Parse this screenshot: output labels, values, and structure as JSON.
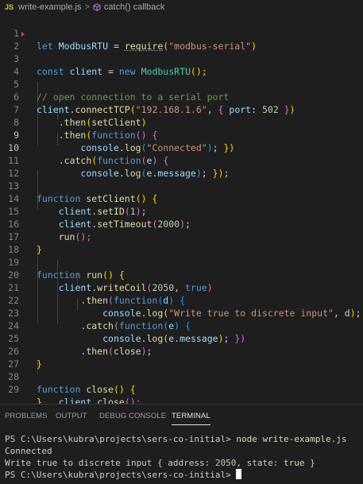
{
  "breadcrumb": {
    "file_badge": "JS",
    "file": "write-example.js",
    "separator": ">",
    "symbol": "catch() callback"
  },
  "editor": {
    "line_numbers": [
      "1",
      "2",
      "3",
      "4",
      "5",
      "6",
      "7",
      "8",
      "9",
      "10",
      "11",
      "12",
      "13",
      "14",
      "15",
      "16",
      "17",
      "18",
      "19",
      "20",
      "21",
      "22",
      "23",
      "24",
      "25",
      "26",
      "27",
      "28",
      "29"
    ],
    "active_line": "9"
  },
  "code": {
    "l1": {
      "let": "let",
      "name": "ModbusRTU",
      "eq": " = ",
      "require": "require",
      "p1": "(",
      "module": "\"modbus-serial\"",
      "p2": ")"
    },
    "l2": {
      "const": "const",
      "sp": " ",
      "client": "client",
      "eq": " = ",
      "new": "new",
      "sp2": " ",
      "cls": "ModbusRTU",
      "parens": "();"
    },
    "l4": {
      "comment": "// open connection to a serial port"
    },
    "l5": {
      "client": "client",
      "dot": ".",
      "fn": "connectTCP",
      "p": "(",
      "ip": "\"192.168.1.6\"",
      "comma": ", ",
      "b": "{",
      "port_key": " port",
      "colon": ": ",
      "port": "502",
      "b2": " }",
      "p2": ")"
    },
    "l6": {
      "dot": ".",
      "then": "then",
      "p": "(",
      "arg": "setClient",
      "p2": ")"
    },
    "l7": {
      "dot": ".",
      "then": "then",
      "p": "(",
      "function": "function",
      "parens": "() ",
      "b": "{"
    },
    "l8": {
      "console": "console",
      "dot": ".",
      "log": "log",
      "p": "(",
      "msg": "\"Connected\"",
      "p2": ")",
      "semi": "; ",
      "b": "})"
    },
    "l9": {
      "dot": ".",
      "catch": "catch",
      "p": "(",
      "function": "function",
      "p3": "(",
      "e": "e",
      "p4": ") ",
      "b": "{"
    },
    "l10": {
      "console": "console",
      "dot": ".",
      "log": "log",
      "p": "(",
      "e": "e",
      "dot2": ".",
      "message": "message",
      "p2": ")",
      "semi": "; ",
      "b": "});"
    },
    "l12": {
      "function": "function",
      "sp": " ",
      "name": "setClient",
      "parens": "() ",
      "b": "{"
    },
    "l13": {
      "client": "client",
      "dot": ".",
      "fn": "setID",
      "p": "(",
      "num": "1",
      "p2": ")",
      "semi": ";"
    },
    "l14": {
      "client": "client",
      "dot": ".",
      "fn": "setTimeout",
      "p": "(",
      "num": "2000",
      "p2": ")",
      "semi": ";"
    },
    "l15": {
      "fn": "run",
      "parens": "();"
    },
    "l16": {
      "b": "}"
    },
    "l18": {
      "function": "function",
      "sp": " ",
      "name": "run",
      "parens": "() ",
      "b": "{"
    },
    "l19": {
      "client": "client",
      "dot": ".",
      "fn": "writeCoil",
      "p": "(",
      "num": "2050",
      "comma": ", ",
      "bool": "true",
      "p2": ")"
    },
    "l20": {
      "dot": ".",
      "then": "then",
      "p": "(",
      "function": "function",
      "p3": "(",
      "d": "d",
      "p4": ") ",
      "b": "{"
    },
    "l21": {
      "console": "console",
      "dot": ".",
      "log": "log",
      "p": "(",
      "msg": "\"Write true to discrete input\"",
      "comma": ", ",
      "d": "d",
      "p2": ")",
      "semi": "; ",
      "b": "})"
    },
    "l22": {
      "dot": ".",
      "catch": "catch",
      "p": "(",
      "function": "function",
      "p3": "(",
      "e": "e",
      "p4": ") ",
      "b": "{"
    },
    "l23": {
      "console": "console",
      "dot": ".",
      "log": "log",
      "p": "(",
      "e": "e",
      "dot2": ".",
      "message": "message",
      "p2": ")",
      "semi": "; ",
      "b": "})"
    },
    "l24": {
      "dot": ".",
      "then": "then",
      "p": "(",
      "arg": "close",
      "p2": ")",
      "semi": ";"
    },
    "l25": {
      "b": "}"
    },
    "l27": {
      "function": "function",
      "sp": " ",
      "name": "close",
      "parens": "() ",
      "b": "{"
    },
    "l28": {
      "client": "client",
      "dot": ".",
      "fn": "close",
      "parens": "();"
    },
    "l29": {
      "b": "}"
    }
  },
  "panel": {
    "tabs": [
      "PROBLEMS",
      "OUTPUT",
      "DEBUG CONSOLE",
      "TERMINAL"
    ],
    "active_tab": "TERMINAL"
  },
  "terminal": {
    "prompt": "PS C:\\Users\\kubra\\projects\\sers-co-initial> ",
    "command": "node write-example.js",
    "out1": "Connected",
    "out2_a": "Write true to discrete input { address: ",
    "out2_addr": "2050",
    "out2_b": ", state: ",
    "out2_state": "true",
    "out2_c": " }",
    "prompt2": "PS C:\\Users\\kubra\\projects\\sers-co-initial> "
  }
}
